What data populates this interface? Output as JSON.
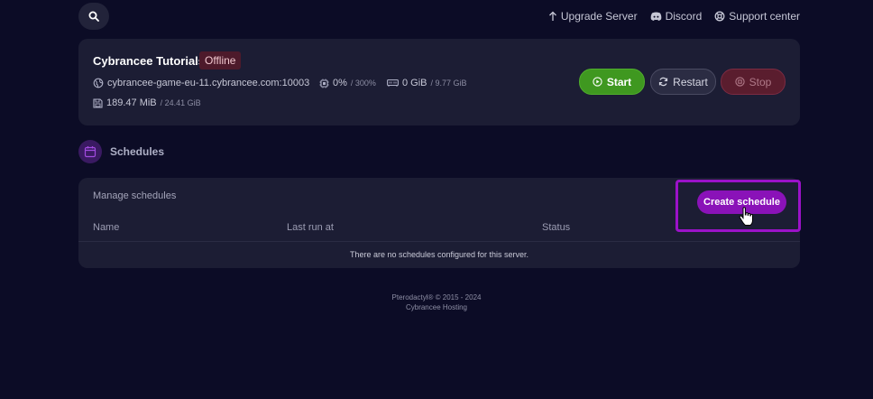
{
  "topbar": {
    "links": [
      {
        "label": "Upgrade Server",
        "icon": "arrow-up-icon"
      },
      {
        "label": "Discord",
        "icon": "discord-icon"
      },
      {
        "label": "Support center",
        "icon": "lifebuoy-icon"
      }
    ]
  },
  "server": {
    "name": "Cybrancee Tutorials",
    "status": "Offline",
    "address": "cybrancee-game-eu-11.cybrancee.com:10003",
    "cpu": {
      "value": "0%",
      "limit": "/ 300%"
    },
    "memory": {
      "value": "0 GiB",
      "limit": "/ 9.77 GiB"
    },
    "disk": {
      "value": "189.47 MiB",
      "limit": "/ 24.41 GiB"
    },
    "buttons": {
      "start": "Start",
      "restart": "Restart",
      "stop": "Stop"
    }
  },
  "schedules": {
    "title": "Schedules",
    "manage_label": "Manage schedules",
    "create_label": "Create schedule",
    "columns": [
      "Name",
      "Last run at",
      "Status"
    ],
    "empty_message": "There are no schedules configured for this server."
  },
  "footer": {
    "line1": "Pterodactyl® © 2015 - 2024",
    "line2": "Cybrancee Hosting"
  },
  "colors": {
    "background": "#0c0c26",
    "card": "#1c1d34",
    "start": "#3f9820",
    "stop": "#5a1d2e",
    "accent": "#8a12b8"
  }
}
